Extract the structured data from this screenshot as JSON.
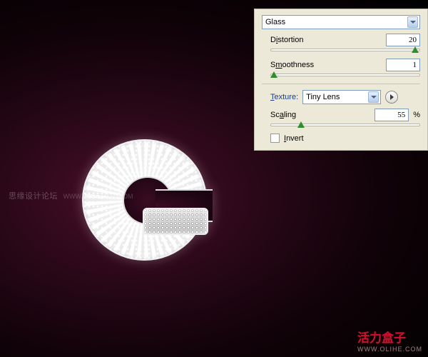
{
  "canvas": {
    "watermark_left_text": "思缘设计论坛",
    "watermark_left_url": "WWW.MISSYUAN.COM",
    "watermark_bottom_text": "活力盒子",
    "watermark_bottom_url": "WWW.OLIHE.COM"
  },
  "panel": {
    "preset_combo": {
      "value": "Glass"
    },
    "distortion": {
      "label_pre": "D",
      "label_u": "i",
      "label_post": "stortion",
      "value": "20",
      "thumb_pct": 97
    },
    "smoothness": {
      "label_pre": "S",
      "label_u": "m",
      "label_post": "oothness",
      "value": "1",
      "thumb_pct": 2
    },
    "texture": {
      "label_u": "T",
      "label_post": "exture:",
      "combo_value": "Tiny Lens"
    },
    "scaling": {
      "label_pre": "Sc",
      "label_u": "a",
      "label_post": "ling",
      "value": "55",
      "unit": "%",
      "thumb_pct": 20
    },
    "invert": {
      "label_u": "I",
      "label_post": "nvert",
      "checked": false
    }
  }
}
